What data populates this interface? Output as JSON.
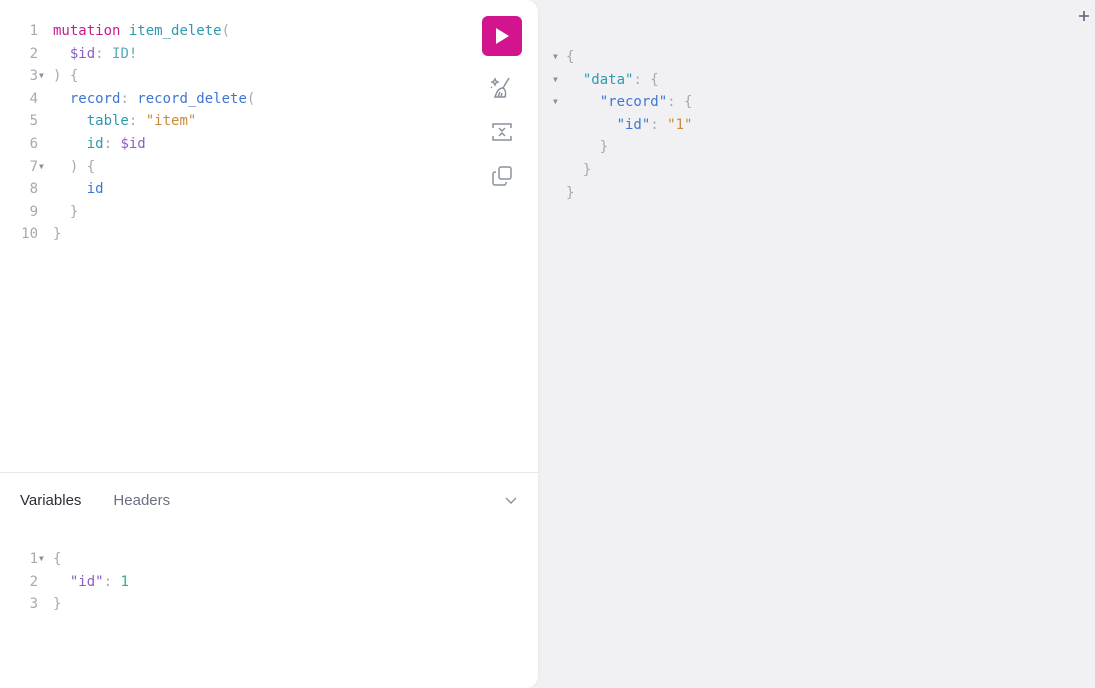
{
  "editor": {
    "lines": [
      {
        "n": "1",
        "fold": false,
        "tokens": [
          [
            "kw",
            "mutation"
          ],
          [
            "punc",
            " "
          ],
          [
            "def",
            "item_delete"
          ],
          [
            "punc",
            "("
          ]
        ]
      },
      {
        "n": "2",
        "fold": false,
        "tokens": [
          [
            "punc",
            "  "
          ],
          [
            "var",
            "$id"
          ],
          [
            "punc",
            ": "
          ],
          [
            "type",
            "ID!"
          ]
        ]
      },
      {
        "n": "3",
        "fold": true,
        "tokens": [
          [
            "punc",
            ") {"
          ]
        ]
      },
      {
        "n": "4",
        "fold": false,
        "tokens": [
          [
            "punc",
            "  "
          ],
          [
            "field",
            "record"
          ],
          [
            "punc",
            ": "
          ],
          [
            "field",
            "record_delete"
          ],
          [
            "punc",
            "("
          ]
        ]
      },
      {
        "n": "5",
        "fold": false,
        "tokens": [
          [
            "punc",
            "    "
          ],
          [
            "arg",
            "table"
          ],
          [
            "punc",
            ": "
          ],
          [
            "str",
            "\"item\""
          ]
        ]
      },
      {
        "n": "6",
        "fold": false,
        "tokens": [
          [
            "punc",
            "    "
          ],
          [
            "arg",
            "id"
          ],
          [
            "punc",
            ": "
          ],
          [
            "var",
            "$id"
          ]
        ]
      },
      {
        "n": "7",
        "fold": true,
        "tokens": [
          [
            "punc",
            "  ) {"
          ]
        ]
      },
      {
        "n": "8",
        "fold": false,
        "tokens": [
          [
            "punc",
            "    "
          ],
          [
            "field",
            "id"
          ]
        ]
      },
      {
        "n": "9",
        "fold": false,
        "tokens": [
          [
            "punc",
            "  }"
          ]
        ]
      },
      {
        "n": "10",
        "fold": false,
        "tokens": [
          [
            "punc",
            "}"
          ]
        ]
      }
    ]
  },
  "toolbar": {
    "run": "execute-query",
    "prettify": "prettify",
    "merge": "merge-fragments",
    "copy": "copy-query"
  },
  "bottom": {
    "tabs": [
      "Variables",
      "Headers"
    ],
    "active_tab": "Variables",
    "variables": [
      {
        "n": "1",
        "fold": true,
        "tokens": [
          [
            "punc",
            "{"
          ]
        ]
      },
      {
        "n": "2",
        "fold": false,
        "tokens": [
          [
            "punc",
            "  "
          ],
          [
            "var-key",
            "\"id\""
          ],
          [
            "punc",
            ": "
          ],
          [
            "num",
            "1"
          ]
        ]
      },
      {
        "n": "3",
        "fold": false,
        "tokens": [
          [
            "punc",
            "}"
          ]
        ]
      }
    ]
  },
  "result": {
    "lines": [
      {
        "fold": true,
        "tokens": [
          [
            "punc",
            "{"
          ]
        ]
      },
      {
        "fold": true,
        "tokens": [
          [
            "punc",
            "  "
          ],
          [
            "json-key-data",
            "\"data\""
          ],
          [
            "punc",
            ": {"
          ]
        ]
      },
      {
        "fold": true,
        "tokens": [
          [
            "punc",
            "    "
          ],
          [
            "json-key",
            "\"record\""
          ],
          [
            "punc",
            ": {"
          ]
        ]
      },
      {
        "fold": false,
        "tokens": [
          [
            "punc",
            "      "
          ],
          [
            "json-key",
            "\"id\""
          ],
          [
            "punc",
            ": "
          ],
          [
            "str",
            "\"1\""
          ]
        ]
      },
      {
        "fold": false,
        "tokens": [
          [
            "punc",
            "    }"
          ]
        ]
      },
      {
        "fold": false,
        "tokens": [
          [
            "punc",
            "  }"
          ]
        ]
      },
      {
        "fold": false,
        "tokens": [
          [
            "punc",
            "}"
          ]
        ]
      }
    ]
  },
  "colors": {
    "accent": "#d2148f",
    "panel_bg": "#ffffff",
    "app_bg": "#f1f1f4"
  }
}
